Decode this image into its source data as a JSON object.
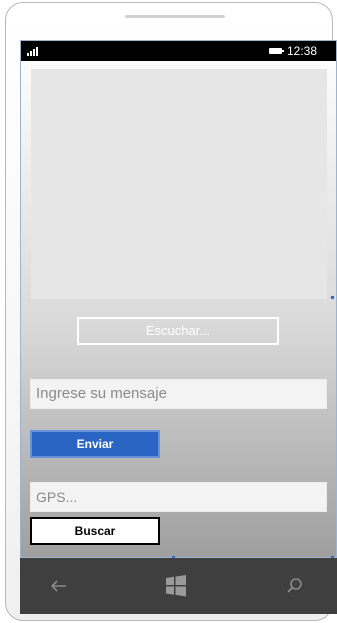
{
  "status_bar": {
    "signal_icon": "signal-bars-icon",
    "battery_icon": "battery-icon",
    "time": "12:38"
  },
  "listen_button": {
    "label": "Escuchar..."
  },
  "message_input": {
    "placeholder": "Ingrese su mensaje",
    "value": ""
  },
  "send_button": {
    "label": "Enviar",
    "color": "#2a65c3"
  },
  "gps_input": {
    "placeholder": "GPS...",
    "value": ""
  },
  "search_button": {
    "label": "Buscar"
  },
  "nav_bar": {
    "back_icon": "back-arrow-icon",
    "home_icon": "windows-logo-icon",
    "search_icon": "search-icon"
  },
  "colors": {
    "accent": "#2a65c3",
    "status_bar": "#000000",
    "nav_bar": "#3f3f3f",
    "selection_handle": "#2f6ad1"
  }
}
